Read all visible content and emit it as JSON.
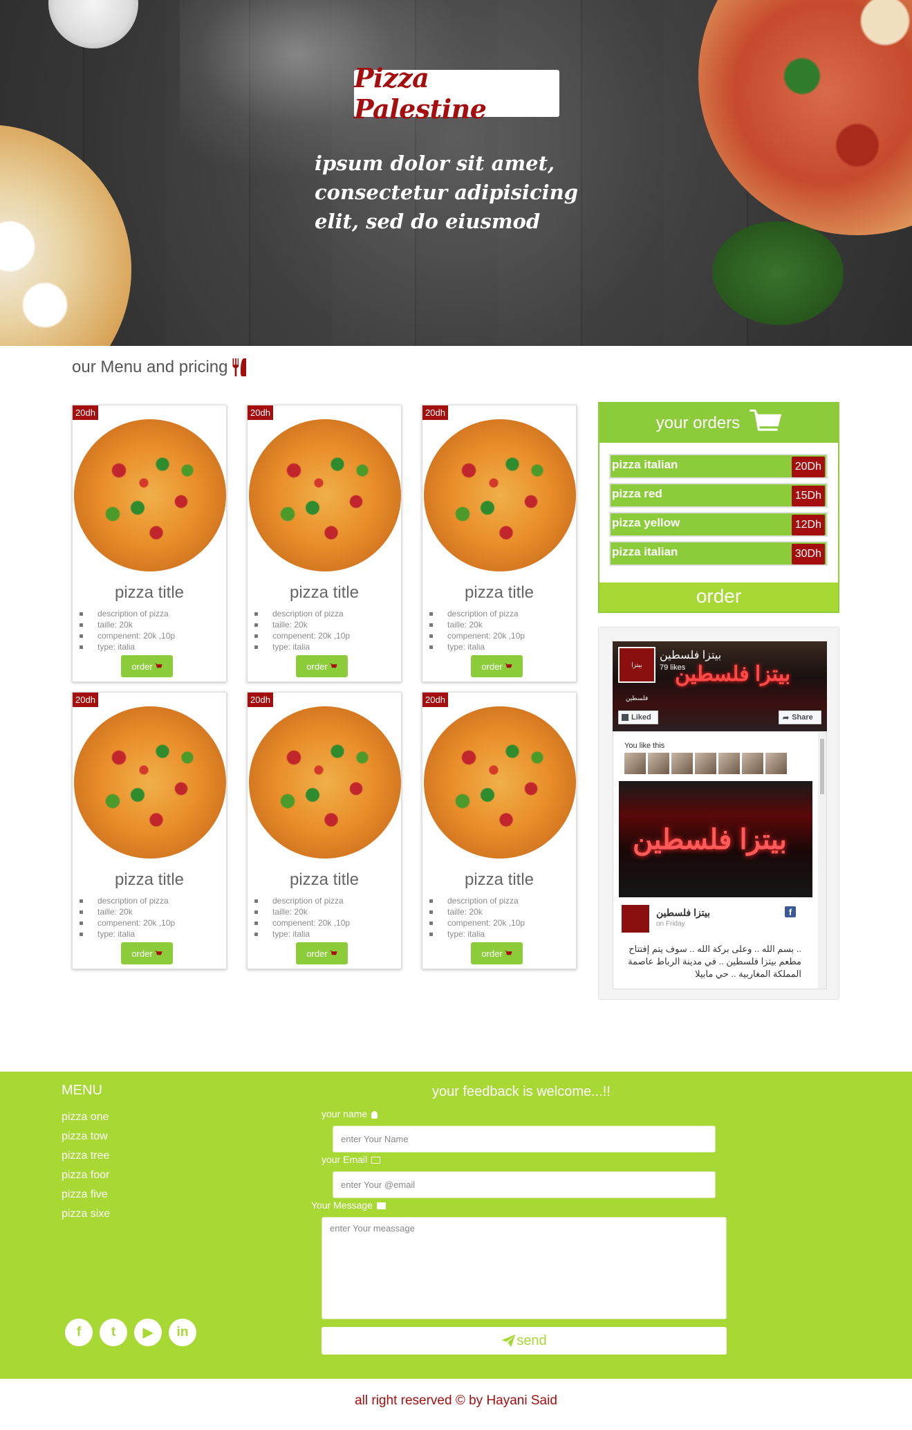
{
  "hero": {
    "title": "Pizza Palestine",
    "tagline": "ipsum dolor sit amet, consectetur adipisicing elit, sed do eiusmod"
  },
  "menu": {
    "heading": "our Menu and pricing",
    "cards": [
      {
        "price": "20dh",
        "title": "pizza title",
        "desc": "description of pizza",
        "taille": "taille: 20k",
        "compenent": "compenent: 20k ,10p",
        "type": "type: italia",
        "order": "order"
      },
      {
        "price": "20dh",
        "title": "pizza title",
        "desc": "description of pizza",
        "taille": "taille: 20k",
        "compenent": "compenent: 20k ,10p",
        "type": "type: italia",
        "order": "order"
      },
      {
        "price": "20dh",
        "title": "pizza title",
        "desc": "description of pizza",
        "taille": "taille: 20k",
        "compenent": "compenent: 20k ,10p",
        "type": "type: italia",
        "order": "order"
      },
      {
        "price": "20dh",
        "title": "pizza title",
        "desc": "description of pizza",
        "taille": "taille: 20k",
        "compenent": "compenent: 20k ,10p",
        "type": "type: italia",
        "order": "order"
      },
      {
        "price": "20dh",
        "title": "pizza title",
        "desc": "description of pizza",
        "taille": "taille: 20k",
        "compenent": "compenent: 20k ,10p",
        "type": "type: italia",
        "order": "order"
      },
      {
        "price": "20dh",
        "title": "pizza title",
        "desc": "description of pizza",
        "taille": "taille: 20k",
        "compenent": "compenent: 20k ,10p",
        "type": "type: italia",
        "order": "order"
      }
    ]
  },
  "orders": {
    "title": "your orders",
    "items": [
      {
        "name": "pizza italian",
        "price": "20Dh"
      },
      {
        "name": "pizza red",
        "price": "15Dh"
      },
      {
        "name": "pizza yellow",
        "price": "12Dh"
      },
      {
        "name": "pizza italian",
        "price": "30Dh"
      }
    ],
    "order_label": "order"
  },
  "facebook": {
    "page_name": "بيتزا فلسطين",
    "likes": "79 likes",
    "logo_text": "بيتزا فلسطين",
    "cover_sign": "بيتزا فلسطين",
    "liked": "Liked",
    "share": "Share",
    "you_like_this": "You like this",
    "post_sign": "بيتزا فلسطين",
    "post_author": "بيتزا فلسطين",
    "post_date": "on Friday",
    "post_text": ".. بسم الله .. وعلى بركة الله .. سوف يتم إفتتاح مطعم بيتزا فلسطين .. في مدينة الرباط عاصمة المملكة المغاربية .. حي مابيلا"
  },
  "footer": {
    "menu_title": "MENU",
    "menu_items": [
      "pizza one",
      "pizza tow",
      "pizza tree",
      "pizza foor",
      "pizza five",
      "pizza sixe"
    ],
    "social": [
      "facebook-icon",
      "twitter-icon",
      "youtube-icon",
      "linkedin-icon"
    ],
    "feedback_title": "your feedback is welcome...!!",
    "name_label": "your name",
    "name_placeholder": "enter Your Name",
    "email_label": "your Email",
    "email_placeholder": "enter Your @email",
    "message_label": "Your Message",
    "message_placeholder": "enter Your meassage",
    "send_label": "send",
    "copyright": "all right reserved © by Hayani Said"
  },
  "colors": {
    "brand_red": "#a50e0e",
    "brand_green": "#8ccc3a",
    "footer_green": "#a8d834"
  }
}
